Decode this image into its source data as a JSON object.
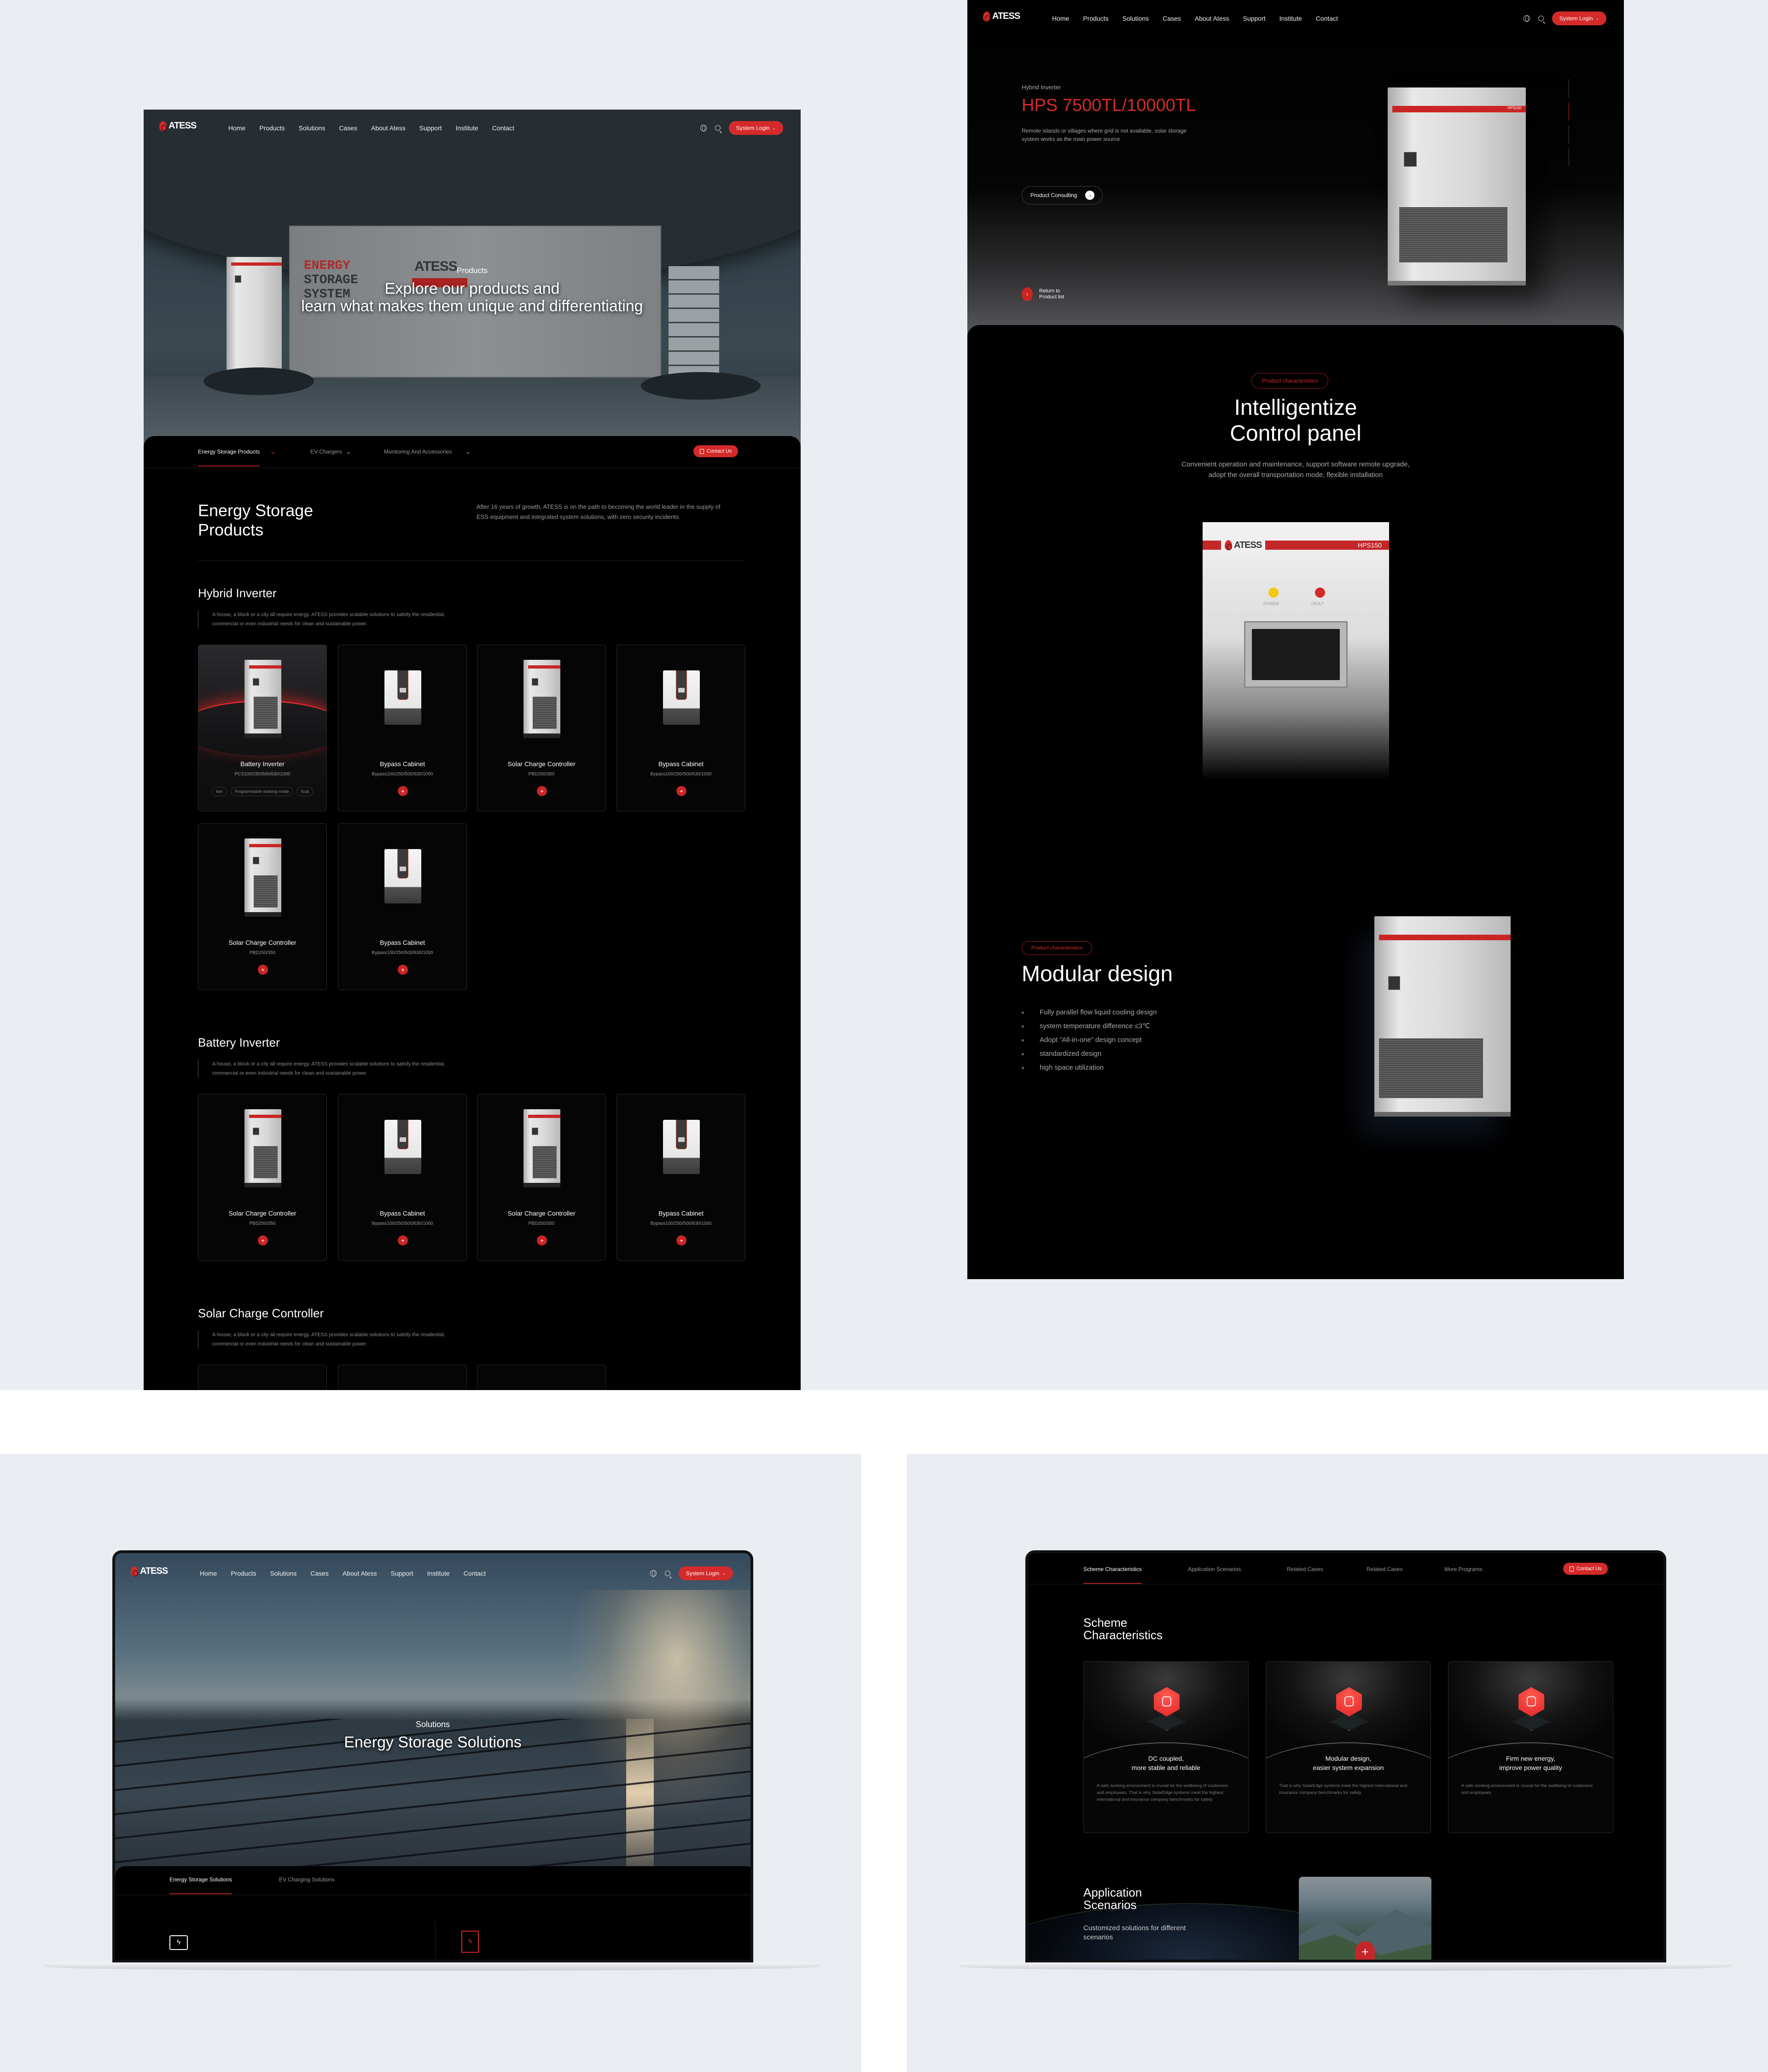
{
  "brand": {
    "logo": "ATESS",
    "accent": "#d42a2a",
    "logo_icon": "flame-icon"
  },
  "nav": {
    "items": [
      "Home",
      "Products",
      "Solutions",
      "Cases",
      "About Atess",
      "Support",
      "Institute",
      "Contact"
    ],
    "login": "System Login",
    "icons": [
      "globe-icon",
      "search-icon"
    ]
  },
  "products_page": {
    "hero": {
      "label": "Products",
      "title_line1": "Explore our products and",
      "title_line2": "learn what makes them unique and differentiating",
      "signage": [
        "ENERGY",
        "STORAGE",
        "SYSTEM"
      ],
      "signage_logo": "ATESS"
    },
    "tabs": [
      "Energy Storage Products",
      "EV Chargers",
      "Monitoring And Accessories"
    ],
    "contact": "Contact Us",
    "heading_line1": "Energy Storage",
    "heading_line2": "Products",
    "intro": "After 16 years of growth, ATESS is on the path to becoming the world leader in the supply of ESS equipment and integrated system solutions, with zero security incidents.",
    "sections": [
      {
        "title": "Hybrid Inverter",
        "desc": "A house, a block or a city all require energy.  ATESS provides scalable solutions to satisfy the residential, commercial or even industrial needs for clean and sustainable power.",
        "cards": [
          {
            "title": "Battery Inverter",
            "model": "PCS100/250/500/630/1000",
            "image": "cabinet",
            "highlighted": true,
            "tags": [
              "tion",
              "Programmable working mode",
              "Scal"
            ]
          },
          {
            "title": "Bypass Cabinet",
            "model": "Bypass100/250/500/630/1000",
            "image": "wall-unit"
          },
          {
            "title": "Solar Charge Controller",
            "model": "PBD250/350",
            "image": "cabinet"
          },
          {
            "title": "Bypass Cabinet",
            "model": "Bypass100/250/500/630/1000",
            "image": "wall-unit"
          },
          {
            "title": "Solar Charge Controller",
            "model": "PBD250/350",
            "image": "cabinet"
          },
          {
            "title": "Bypass Cabinet",
            "model": "Bypass100/250/500/630/1000",
            "image": "wall-unit"
          }
        ]
      },
      {
        "title": "Battery Inverter",
        "desc": "A house, a block or a city all require energy.  ATESS provides scalable solutions to satisfy the residential, commercial or even industrial needs for clean and sustainable power.",
        "cards": [
          {
            "title": "Solar Charge Controller",
            "model": "PBD250/350",
            "image": "cabinet"
          },
          {
            "title": "Bypass Cabinet",
            "model": "Bypass100/250/500/630/1000",
            "image": "wall-unit"
          },
          {
            "title": "Solar Charge Controller",
            "model": "PBD250/350",
            "image": "cabinet"
          },
          {
            "title": "Bypass Cabinet",
            "model": "Bypass100/250/500/630/1000",
            "image": "wall-unit"
          }
        ]
      },
      {
        "title": "Solar Charge Controller",
        "desc": "A house, a block or a city all require energy.  ATESS provides scalable solutions to satisfy the residential, commercial or even industrial needs for clean and sustainable power.",
        "cards": [
          {},
          {},
          {}
        ]
      }
    ]
  },
  "detail_page": {
    "category": "Hybrid Inverter",
    "title": "HPS 7500TL/10000TL",
    "desc": "Remote islands or villages where grid is not available, solar storage system works as the main power source",
    "consult": "Product Consulting",
    "back_line1": "Return to",
    "back_line2": "Product list",
    "cabinet_model": "HPS150",
    "feature1": {
      "pill": "Product characteristics",
      "title_line1": "Intelligentize",
      "title_line2": "Control panel",
      "desc_line1": "Convenient operation and maintenance, support software remote upgrade,",
      "desc_line2": "adopt the overall transportation mode, flexible installation",
      "panel_logo": "ATESS",
      "panel_model": "HPS150",
      "led_power": "POWER",
      "led_fault": "FAULT"
    },
    "feature2": {
      "pill": "Product characteristics",
      "title": "Modular design",
      "bullets": [
        "Fully parallel flow liquid cooling design",
        "system temperature difference ≤3℃",
        "Adopt ”All-in-one” design concept",
        "standardized design",
        "high space utilization"
      ]
    }
  },
  "solutions_page": {
    "hero_label": "Solutions",
    "hero_title": "Energy Storage Solutions",
    "tabs": [
      "Energy Storage Solutions",
      "EV Charging Solutions"
    ],
    "icons": [
      "battery-charge-icon",
      "charging-station-icon"
    ]
  },
  "scheme_page": {
    "tabs": [
      "Scheme Characteristics",
      "Application Scenarios",
      "Related Cases",
      "Related Cases",
      "More Programs"
    ],
    "contact": "Contact Us",
    "heading_line1": "Scheme",
    "heading_line2": "Characteristics",
    "cards": [
      {
        "title_line1": "DC coupled,",
        "title_line2": "more stable and reliable",
        "desc": "A safe working environment is crucial for the wellbeing of customers and employees. That is why SolarEdge systems meet the highest international and insurance company benchmarks for safety.",
        "icon": "dc-coupled-icon"
      },
      {
        "title_line1": "Modular design,",
        "title_line2": "easier system expansion",
        "desc": "That is why SolarEdge systems meet the highest international and insurance company benchmarks for safety.",
        "icon": "modular-icon"
      },
      {
        "title_line1": "Firm new energy,",
        "title_line2": "improve power quality",
        "desc": "A safe working environment is crucial for the wellbeing of customers and employees.",
        "icon": "lightbulb-icon"
      }
    ],
    "app_line1": "Application",
    "app_line2": "Scenarios",
    "app_desc": "Customized solutions for different scenarios"
  }
}
